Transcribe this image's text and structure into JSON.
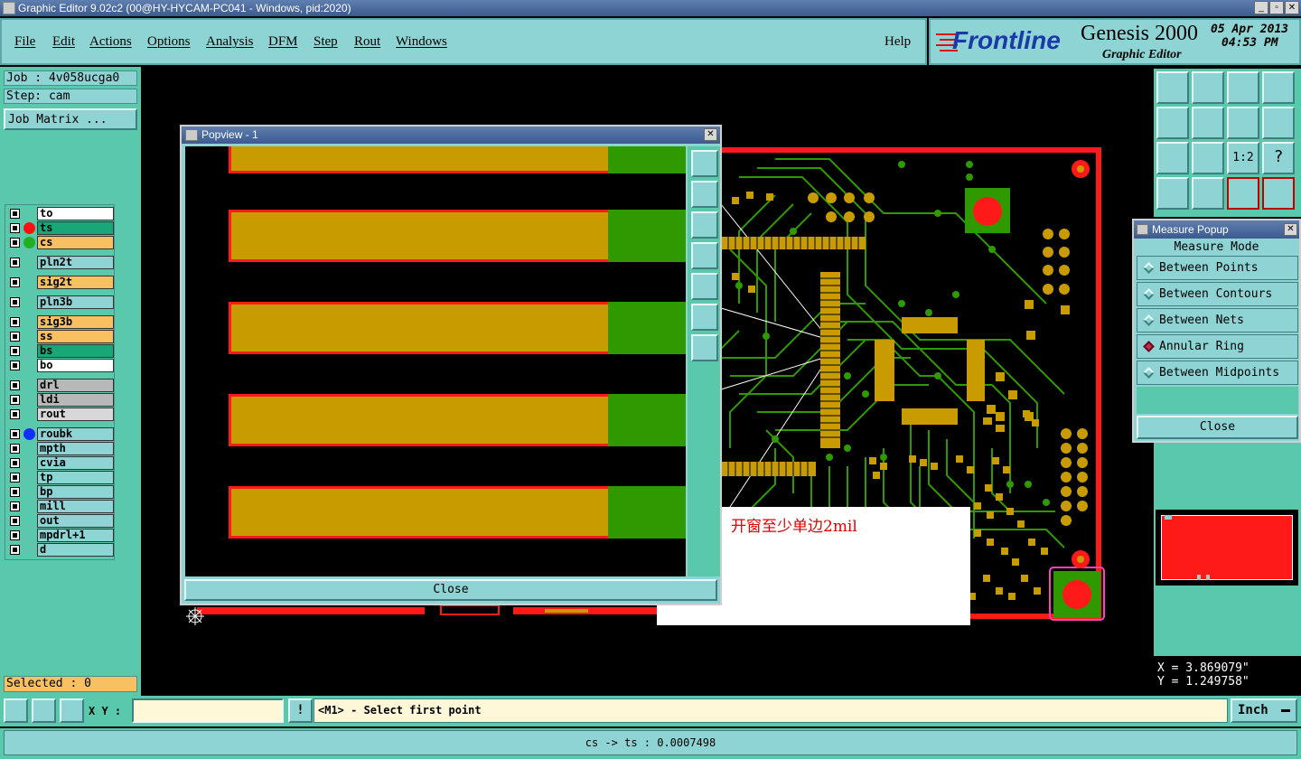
{
  "window": {
    "title": "Graphic Editor 9.02c2 (00@HY-HYCAM-PC041 - Windows, pid:2020)",
    "min": "_",
    "restore": "▫",
    "close": "✕"
  },
  "menu": {
    "items": [
      "File",
      "Edit",
      "Actions",
      "Options",
      "Analysis",
      "DFM",
      "Step",
      "Rout",
      "Windows"
    ],
    "help": "Help"
  },
  "brand": {
    "logo": "Frontline",
    "product": "Genesis 2000",
    "subtitle": "Graphic Editor",
    "date": "05 Apr 2013",
    "time": "04:53 PM"
  },
  "job": {
    "job_label": "Job : 4v058ucga0",
    "step_label": "Step: cam",
    "matrix_button": "Job Matrix ..."
  },
  "layers": [
    {
      "name": "to",
      "color": "#ffffff",
      "dot": ""
    },
    {
      "name": "ts",
      "color": "#18a878",
      "dot": "#ff1010"
    },
    {
      "name": "cs",
      "color": "#f8c060",
      "dot": "#20b020"
    },
    {
      "name": "pln2t",
      "color": "#8ed4d4",
      "dot": ""
    },
    {
      "name": "sig2t",
      "color": "#f8c060",
      "dot": ""
    },
    {
      "name": "pln3b",
      "color": "#8ed4d4",
      "dot": ""
    },
    {
      "name": "sig3b",
      "color": "#f8c060",
      "dot": ""
    },
    {
      "name": "ss",
      "color": "#f8c060",
      "dot": ""
    },
    {
      "name": "bs",
      "color": "#18a878",
      "dot": ""
    },
    {
      "name": "bo",
      "color": "#ffffff",
      "dot": ""
    },
    {
      "name": "drl",
      "color": "#b8b8b8",
      "dot": ""
    },
    {
      "name": "ldi",
      "color": "#b8b8b8",
      "dot": ""
    },
    {
      "name": "rout",
      "color": "#d8d8d8",
      "dot": ""
    },
    {
      "name": "roubk",
      "color": "#8ed4d4",
      "dot": "#1030ff"
    },
    {
      "name": "mpth",
      "color": "#8ed4d4",
      "dot": ""
    },
    {
      "name": "cvia",
      "color": "#8ed4d4",
      "dot": ""
    },
    {
      "name": "tp",
      "color": "#8ed4d4",
      "dot": ""
    },
    {
      "name": "bp",
      "color": "#8ed4d4",
      "dot": ""
    },
    {
      "name": "mill",
      "color": "#8ed4d4",
      "dot": ""
    },
    {
      "name": "out",
      "color": "#8ed4d4",
      "dot": ""
    },
    {
      "name": "mpdrl+1",
      "color": "#8ed4d4",
      "dot": ""
    },
    {
      "name": "d",
      "color": "#8ed4d4",
      "dot": ""
    }
  ],
  "selected": "Selected : 0",
  "popview": {
    "title": "Popview - 1",
    "close": "Close"
  },
  "annotation": "开窗至少单边2mil",
  "measure": {
    "title": "Measure Popup",
    "mode_label": "Measure Mode",
    "options": [
      "Between Points",
      "Between Contours",
      "Between Nets",
      "Annular Ring",
      "Between Midpoints"
    ],
    "selected": "Annular Ring",
    "close": "Close"
  },
  "coords": {
    "x": "X = 3.869079\"",
    "y": "Y = 1.249758\""
  },
  "input": {
    "xy_label": "X Y :",
    "prompt": "<M1> - Select first point",
    "units": "Inch"
  },
  "status": "cs -> ts : 0.0007498"
}
